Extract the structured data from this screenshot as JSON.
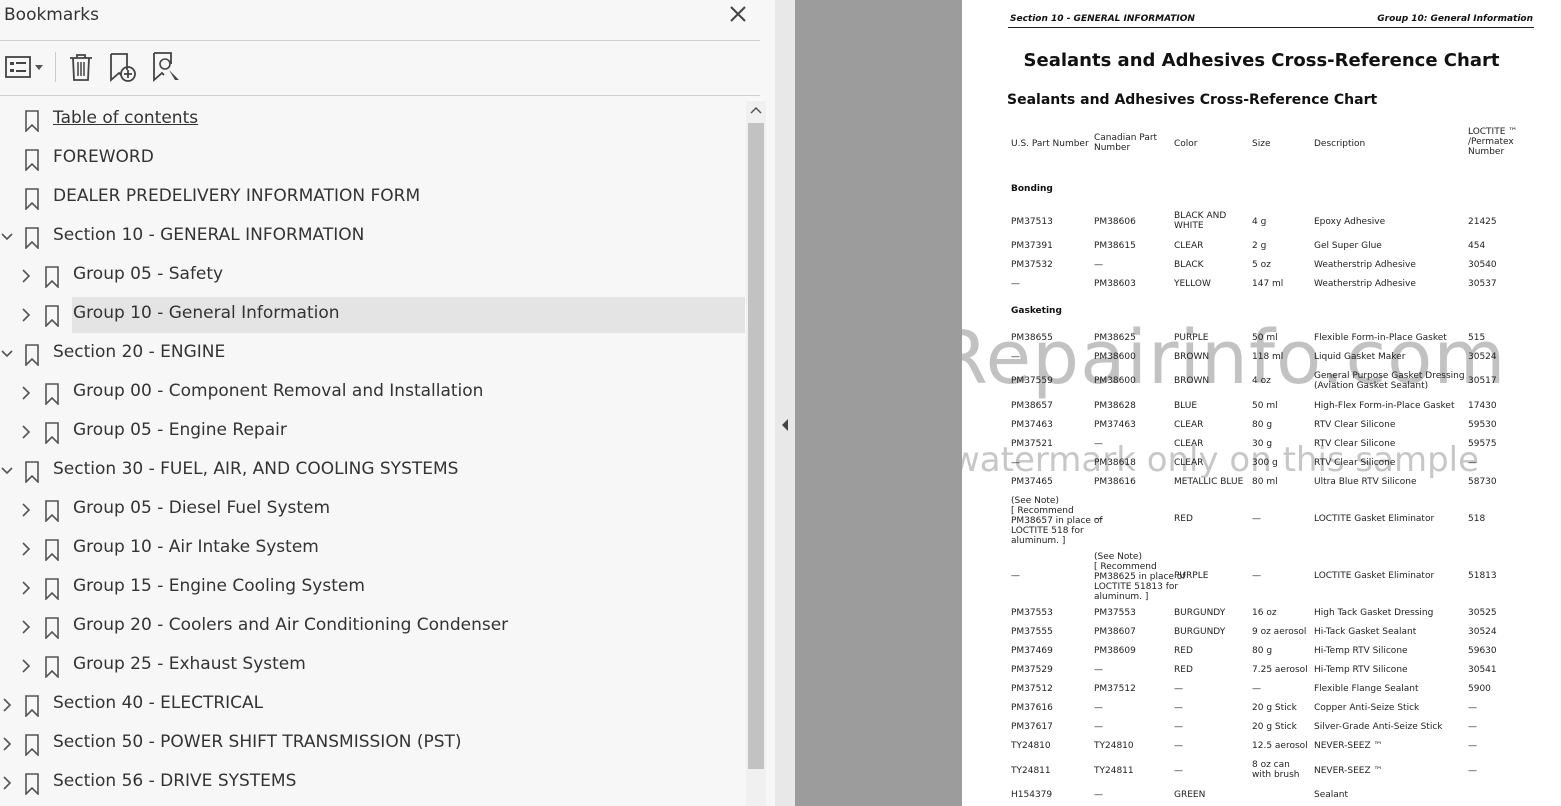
{
  "panel": {
    "title": "Bookmarks",
    "items": [
      {
        "label": "Table of contents",
        "level": 0,
        "expander": "none",
        "link": true
      },
      {
        "label": "FOREWORD",
        "level": 0,
        "expander": "none"
      },
      {
        "label": "DEALER PREDELIVERY INFORMATION FORM",
        "level": 0,
        "expander": "none"
      },
      {
        "label": "Section 10 - GENERAL INFORMATION",
        "level": 0,
        "expander": "open"
      },
      {
        "label": "Group 05 - Safety",
        "level": 1,
        "expander": "closed"
      },
      {
        "label": "Group 10 - General Information",
        "level": 1,
        "expander": "closed",
        "selected": true
      },
      {
        "label": "Section 20 - ENGINE",
        "level": 0,
        "expander": "open"
      },
      {
        "label": "Group 00 - Component Removal and Installation",
        "level": 1,
        "expander": "closed"
      },
      {
        "label": "Group 05 - Engine Repair",
        "level": 1,
        "expander": "closed"
      },
      {
        "label": "Section 30 - FUEL, AIR, AND COOLING SYSTEMS",
        "level": 0,
        "expander": "open"
      },
      {
        "label": "Group 05 - Diesel Fuel System",
        "level": 1,
        "expander": "closed"
      },
      {
        "label": "Group 10 - Air Intake System",
        "level": 1,
        "expander": "closed"
      },
      {
        "label": "Group 15 - Engine Cooling System",
        "level": 1,
        "expander": "closed"
      },
      {
        "label": "Group 20 - Coolers and Air Conditioning Condenser",
        "level": 1,
        "expander": "closed"
      },
      {
        "label": "Group 25 - Exhaust System",
        "level": 1,
        "expander": "closed"
      },
      {
        "label": "Section 40 - ELECTRICAL",
        "level": 0,
        "expander": "closed"
      },
      {
        "label": "Section 50 - POWER SHIFT TRANSMISSION (PST)",
        "level": 0,
        "expander": "closed"
      },
      {
        "label": "Section 56 - DRIVE SYSTEMS",
        "level": 0,
        "expander": "closed"
      }
    ]
  },
  "document": {
    "header_left": "Section 10 - GENERAL INFORMATION",
    "header_right": "Group 10: General Information",
    "title": "Sealants and Adhesives Cross-Reference Chart",
    "subtitle": "Sealants and Adhesives Cross-Reference Chart",
    "columns": [
      "U.S. Part Number",
      "Canadian Part\nNumber",
      "Color",
      "Size",
      "Description",
      "LOCTITE ™\n/Permatex\nNumber"
    ],
    "categories": [
      {
        "name": "Bonding"
      },
      {
        "name": "Gasketing"
      }
    ],
    "rows": [
      [
        "PM37513",
        "PM38606",
        "BLACK AND\nWHITE",
        "4 g",
        "Epoxy Adhesive",
        "21425"
      ],
      [
        "PM37391",
        "PM38615",
        "CLEAR",
        "2 g",
        "Gel Super Glue",
        "454"
      ],
      [
        "PM37532",
        "—",
        "BLACK",
        "5 oz",
        "Weatherstrip Adhesive",
        "30540"
      ],
      [
        "—",
        "PM38603",
        "YELLOW",
        "147 ml",
        "Weatherstrip Adhesive",
        "30537"
      ],
      [
        "PM38655",
        "PM38625",
        "PURPLE",
        "50 ml",
        "Flexible Form-in-Place Gasket",
        "515"
      ],
      [
        "—",
        "PM38600",
        "BROWN",
        "118 ml",
        "Liquid Gasket Maker",
        "30524"
      ],
      [
        "PM37559",
        "PM38600",
        "BROWN",
        "4 oz",
        "General Purpose Gasket Dressing\n(Aviation Gasket Sealant)",
        "30517"
      ],
      [
        "PM38657",
        "PM38628",
        "BLUE",
        "50 ml",
        "High-Flex Form-in-Place Gasket",
        "17430"
      ],
      [
        "PM37463",
        "PM37463",
        "CLEAR",
        "80 g",
        "RTV Clear Silicone",
        "59530"
      ],
      [
        "PM37521",
        "—",
        "CLEAR",
        "30 g",
        "RTV Clear Silicone",
        "59575"
      ],
      [
        "—",
        "PM38618",
        "CLEAR",
        "300 g",
        "RTV Clear Silicone",
        "—"
      ],
      [
        "PM37465",
        "PM38616",
        "METALLIC BLUE",
        "80 ml",
        "Ultra Blue RTV Silicone",
        "58730"
      ],
      [
        "(See Note)\n[ Recommend\nPM38657 in place of\nLOCTITE 518 for\naluminum. ]",
        "—",
        "RED",
        "—",
        "LOCTITE Gasket Eliminator",
        "518"
      ],
      [
        "—",
        "(See Note)\n[ Recommend\nPM38625 in place of\nLOCTITE 51813 for\naluminum. ]",
        "PURPLE",
        "—",
        "LOCTITE Gasket Eliminator",
        "51813"
      ],
      [
        "PM37553",
        "PM37553",
        "BURGUNDY",
        "16 oz",
        "High Tack Gasket Dressing",
        "30525"
      ],
      [
        "PM37555",
        "PM38607",
        "BURGUNDY",
        "9 oz aerosol",
        "Hi-Tack Gasket Sealant",
        "30524"
      ],
      [
        "PM37469",
        "PM38609",
        "RED",
        "80 g",
        "Hi-Temp RTV Silicone",
        "59630"
      ],
      [
        "PM37529",
        "—",
        "RED",
        "7.25 aerosol",
        "Hi-Temp RTV Silicone",
        "30541"
      ],
      [
        "PM37512",
        "PM37512",
        "—",
        "—",
        "Flexible Flange Sealant",
        "5900"
      ],
      [
        "PM37616",
        "—",
        "—",
        "20 g Stick",
        "Copper Anti-Seize Stick",
        "—"
      ],
      [
        "PM37617",
        "—",
        "—",
        "20 g Stick",
        "Silver-Grade Anti-Seize Stick",
        "—"
      ],
      [
        "TY24810",
        "TY24810",
        "—",
        "12.5 aerosol",
        "NEVER-SEEZ ™",
        "—"
      ],
      [
        "TY24811",
        "TY24811",
        "—",
        "8 oz can\nwith brush",
        "NEVER-SEEZ ™",
        "—"
      ],
      [
        "H154379",
        "—",
        "GREEN",
        "",
        "Sealant",
        ""
      ]
    ],
    "watermark": "eRepairinfo.com",
    "watermark_note": "watermark only on this sample"
  }
}
